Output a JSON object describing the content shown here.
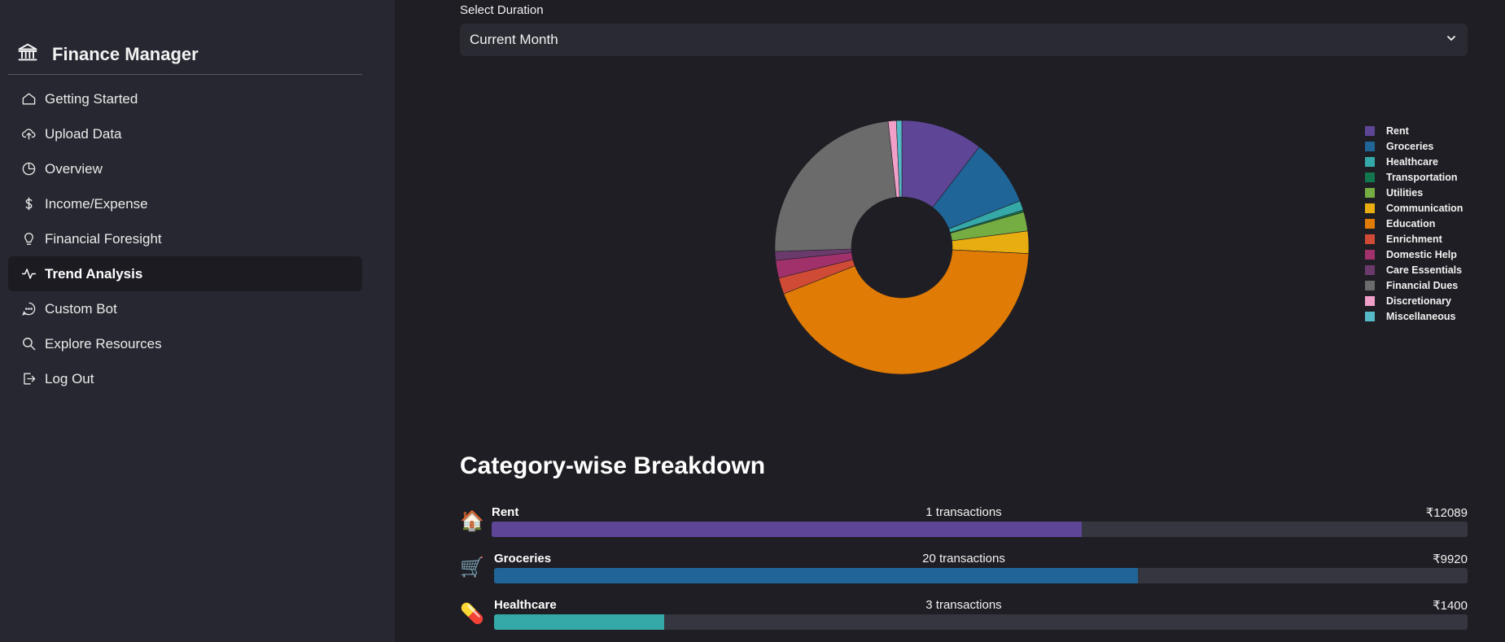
{
  "sidebar": {
    "brand": {
      "title": "Finance Manager",
      "icon": "bank-icon"
    },
    "items": [
      {
        "label": "Getting Started",
        "icon": "home-icon",
        "active": false
      },
      {
        "label": "Upload Data",
        "icon": "cloud-upload-icon",
        "active": false
      },
      {
        "label": "Overview",
        "icon": "pie-chart-icon",
        "active": false
      },
      {
        "label": "Income/Expense",
        "icon": "dollar-icon",
        "active": false
      },
      {
        "label": "Financial Foresight",
        "icon": "lightbulb-icon",
        "active": false
      },
      {
        "label": "Trend Analysis",
        "icon": "activity-icon",
        "active": true
      },
      {
        "label": "Custom Bot",
        "icon": "chat-icon",
        "active": false
      },
      {
        "label": "Explore Resources",
        "icon": "search-icon",
        "active": false
      },
      {
        "label": "Log Out",
        "icon": "logout-icon",
        "active": false
      }
    ]
  },
  "duration": {
    "label": "Select Duration",
    "value": "Current Month"
  },
  "chart_data": {
    "type": "pie",
    "donut": true,
    "legend_position": "right",
    "categories": [
      "Rent",
      "Groceries",
      "Healthcare",
      "Transportation",
      "Utilities",
      "Communication",
      "Education",
      "Enrichment",
      "Domestic Help",
      "Care Essentials",
      "Financial Dues",
      "Discretionary",
      "Miscellaneous"
    ],
    "values": [
      12089,
      9920,
      1400,
      300,
      2800,
      3300,
      50000,
      2400,
      2600,
      1300,
      27500,
      1200,
      800
    ],
    "colors": [
      "#5e4596",
      "#1f6597",
      "#35a9a8",
      "#13774e",
      "#75ad42",
      "#e8ad10",
      "#e07b05",
      "#d04b35",
      "#a0316b",
      "#6b3a6c",
      "#6b6b6b",
      "#f0a0c8",
      "#56b9c8"
    ]
  },
  "breakdown": {
    "title": "Category-wise Breakdown",
    "rows": [
      {
        "emoji": "🏠",
        "name": "Rent",
        "count": "1 transactions",
        "amount": "₹12089",
        "fraction": 0.605,
        "color": "#5e4596"
      },
      {
        "emoji": "🛒",
        "name": "Groceries",
        "count": "20 transactions",
        "amount": "₹9920",
        "fraction": 0.661,
        "color": "#1f6597"
      },
      {
        "emoji": "💊",
        "name": "Healthcare",
        "count": "3 transactions",
        "amount": "₹1400",
        "fraction": 0.175,
        "color": "#35a9a8"
      }
    ]
  }
}
